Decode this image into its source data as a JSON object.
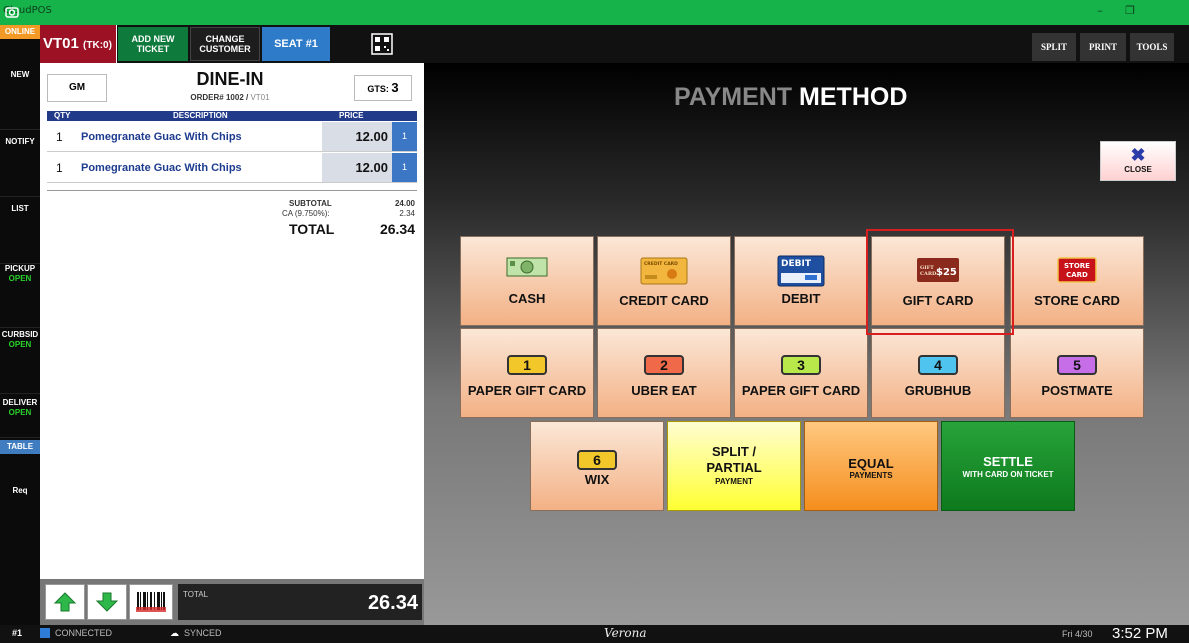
{
  "window": {
    "title": "CloudPOS"
  },
  "rail": {
    "online": "ONLINE",
    "items": [
      {
        "label": "NEW",
        "sub": ""
      },
      {
        "label": "NOTIFY",
        "sub": ""
      },
      {
        "label": "LIST",
        "sub": ""
      },
      {
        "label": "PICKUP",
        "sub": "OPEN"
      },
      {
        "label": "CURBSID",
        "sub": "OPEN"
      },
      {
        "label": "DELIVER",
        "sub": "OPEN"
      }
    ],
    "table": "TABLE",
    "req": "Req"
  },
  "toolbar": {
    "ticket": "VT01",
    "ticket_tk": "(TK:0)",
    "add_ticket": "ADD NEW TICKET",
    "change_customer": "CHANGE CUSTOMER",
    "seat": "SEAT #1",
    "split": "SPLIT",
    "print": "PRINT",
    "tools": "TOOLS"
  },
  "ticket": {
    "server": "GM",
    "type": "DINE-IN",
    "order_label": "ORDER# 1002 /",
    "order_vt": "VT01",
    "gts_label": "GTS:",
    "gts_value": "3",
    "columns": {
      "qty": "QTY",
      "desc": "DESCRIPTION",
      "price": "PRICE"
    },
    "items": [
      {
        "qty": "1",
        "desc": "Pomegranate Guac With Chips",
        "price": "12.00",
        "seat": "1"
      },
      {
        "qty": "1",
        "desc": "Pomegranate Guac With Chips",
        "price": "12.00",
        "seat": "1"
      }
    ],
    "subtotal_label": "SUBTOTAL",
    "subtotal": "24.00",
    "tax_label": "CA (9.750%):",
    "tax": "2.34",
    "total_label": "TOTAL",
    "total": "26.34",
    "bottom_total_label": "TOTAL",
    "bottom_total": "26.34"
  },
  "payment": {
    "title_a": "PAYMENT",
    "title_b": "METHOD",
    "close": "CLOSE",
    "row1": [
      "CASH",
      "CREDIT CARD",
      "DEBIT",
      "GIFT CARD",
      "STORE CARD"
    ],
    "row2": [
      {
        "num": "1",
        "label": "PAPER GIFT CARD",
        "color": "#f2c72a"
      },
      {
        "num": "2",
        "label": "UBER EAT",
        "color": "#f06a4a"
      },
      {
        "num": "3",
        "label": "PAPER GIFT CARD",
        "color": "#b9e84a"
      },
      {
        "num": "4",
        "label": "GRUBHUB",
        "color": "#4ec4ee"
      },
      {
        "num": "5",
        "label": "POSTMATE",
        "color": "#c56ee8"
      }
    ],
    "wix": {
      "num": "6",
      "label": "WIX",
      "color": "#f2c72a"
    },
    "split": {
      "title": "SPLIT /",
      "title2": "PARTIAL",
      "sub": "PAYMENT"
    },
    "equal": {
      "title": "EQUAL",
      "sub": "PAYMENTS"
    },
    "settle": {
      "title": "SETTLE",
      "sub": "WITH CARD ON TICKET"
    },
    "icons": {
      "debit_text": "DEBIT",
      "gift_text": "GIFT",
      "gift_card_text": "CARD",
      "gift_amount": "$25",
      "store_text": "STORE",
      "store_card_text": "CARD",
      "credit_text": "CREDIT CARD"
    }
  },
  "status": {
    "station": "#1",
    "connected": "CONNECTED",
    "synced": "SYNCED",
    "location": "Verona",
    "date": "Fri 4/30",
    "time": "3:52 PM"
  }
}
